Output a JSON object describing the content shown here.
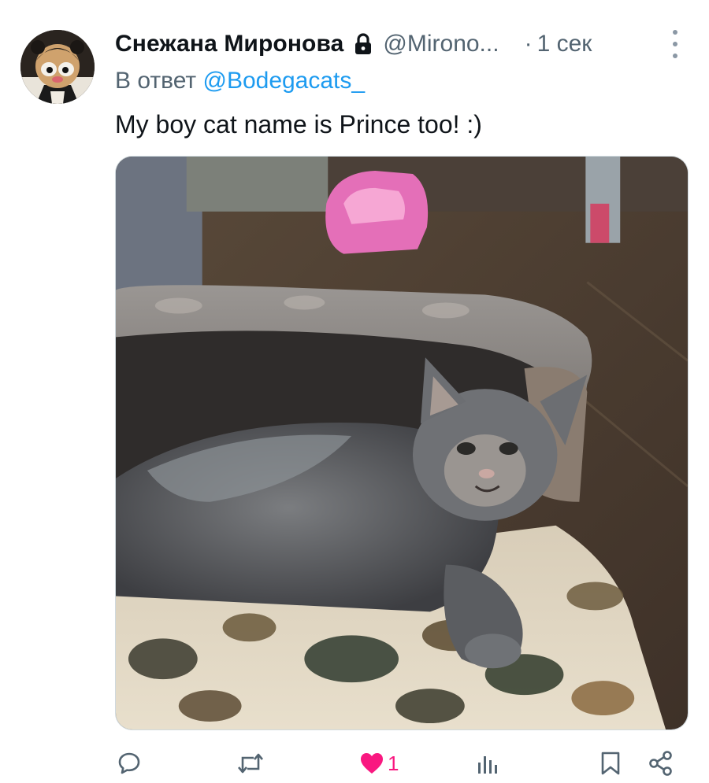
{
  "tweet": {
    "display_name": "Снежана Миронова",
    "handle": "@Mirono...",
    "separator": "·",
    "time": "1 сек",
    "reply_prefix": "В ответ",
    "reply_mention": "@Bodegacats_",
    "text": "My boy cat name is Prince too! :)",
    "like_count": "1",
    "liked": true
  },
  "colors": {
    "text_primary": "#0f1419",
    "text_secondary": "#536471",
    "link": "#1d9bf0",
    "like": "#f91880"
  },
  "icons": {
    "avatar": "cartoon-character-avatar",
    "protected": "lock-icon",
    "more": "vertical-dots-icon",
    "reply": "comment-icon",
    "retweet": "retweet-icon",
    "like": "heart-filled-icon",
    "views": "bar-chart-icon",
    "bookmark": "bookmark-icon",
    "share": "share-icon"
  },
  "media": {
    "subject": "grey cat lying on a patterned couch"
  }
}
